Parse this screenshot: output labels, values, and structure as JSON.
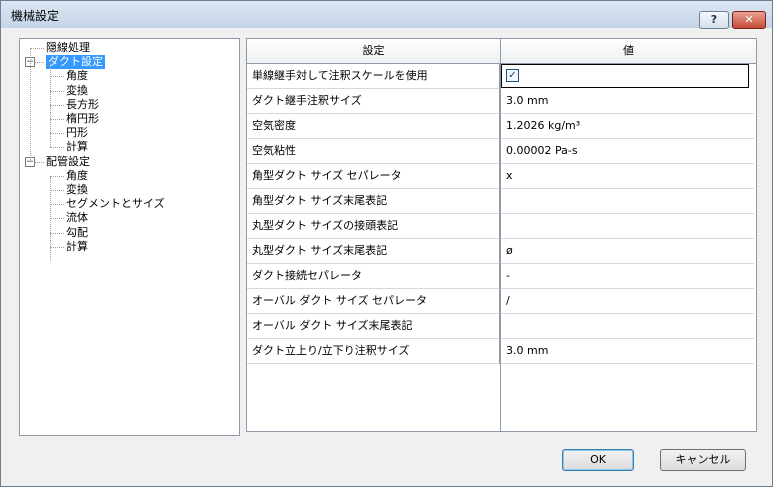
{
  "window": {
    "title": "機械設定",
    "help_label": "?",
    "close_label": "✕"
  },
  "tree": {
    "items": [
      {
        "label": "隠線処理"
      },
      {
        "label": "ダクト設定",
        "expander": "−"
      },
      {
        "label": "角度"
      },
      {
        "label": "変換"
      },
      {
        "label": "長方形"
      },
      {
        "label": "楕円形"
      },
      {
        "label": "円形"
      },
      {
        "label": "計算"
      },
      {
        "label": "配管設定",
        "expander": "−"
      },
      {
        "label": "角度"
      },
      {
        "label": "変換"
      },
      {
        "label": "セグメントとサイズ"
      },
      {
        "label": "流体"
      },
      {
        "label": "勾配"
      },
      {
        "label": "計算"
      }
    ],
    "selected": "ダクト設定"
  },
  "grid": {
    "headers": {
      "setting": "設定",
      "value": "値"
    },
    "rows": [
      {
        "name": "単線継手対して注釈スケールを使用",
        "value": "",
        "checked": true
      },
      {
        "name": "ダクト継手注釈サイズ",
        "value": "3.0 mm"
      },
      {
        "name": "空気密度",
        "value": "1.2026 kg/m³"
      },
      {
        "name": "空気粘性",
        "value": "0.00002 Pa-s"
      },
      {
        "name": "角型ダクト サイズ セパレータ",
        "value": "x"
      },
      {
        "name": "角型ダクト サイズ末尾表記",
        "value": ""
      },
      {
        "name": "丸型ダクト サイズの接頭表記",
        "value": ""
      },
      {
        "name": "丸型ダクト サイズ末尾表記",
        "value": "ø"
      },
      {
        "name": "ダクト接続セパレータ",
        "value": "-"
      },
      {
        "name": "オーバル ダクト サイズ セパレータ",
        "value": "/"
      },
      {
        "name": "オーバル ダクト サイズ末尾表記",
        "value": ""
      },
      {
        "name": "ダクト立上り/立下り注釈サイズ",
        "value": "3.0 mm"
      }
    ]
  },
  "buttons": {
    "ok": "OK",
    "cancel": "キャンセル"
  },
  "colors": {
    "selection": "#3399ff",
    "close": "#c54a36"
  }
}
